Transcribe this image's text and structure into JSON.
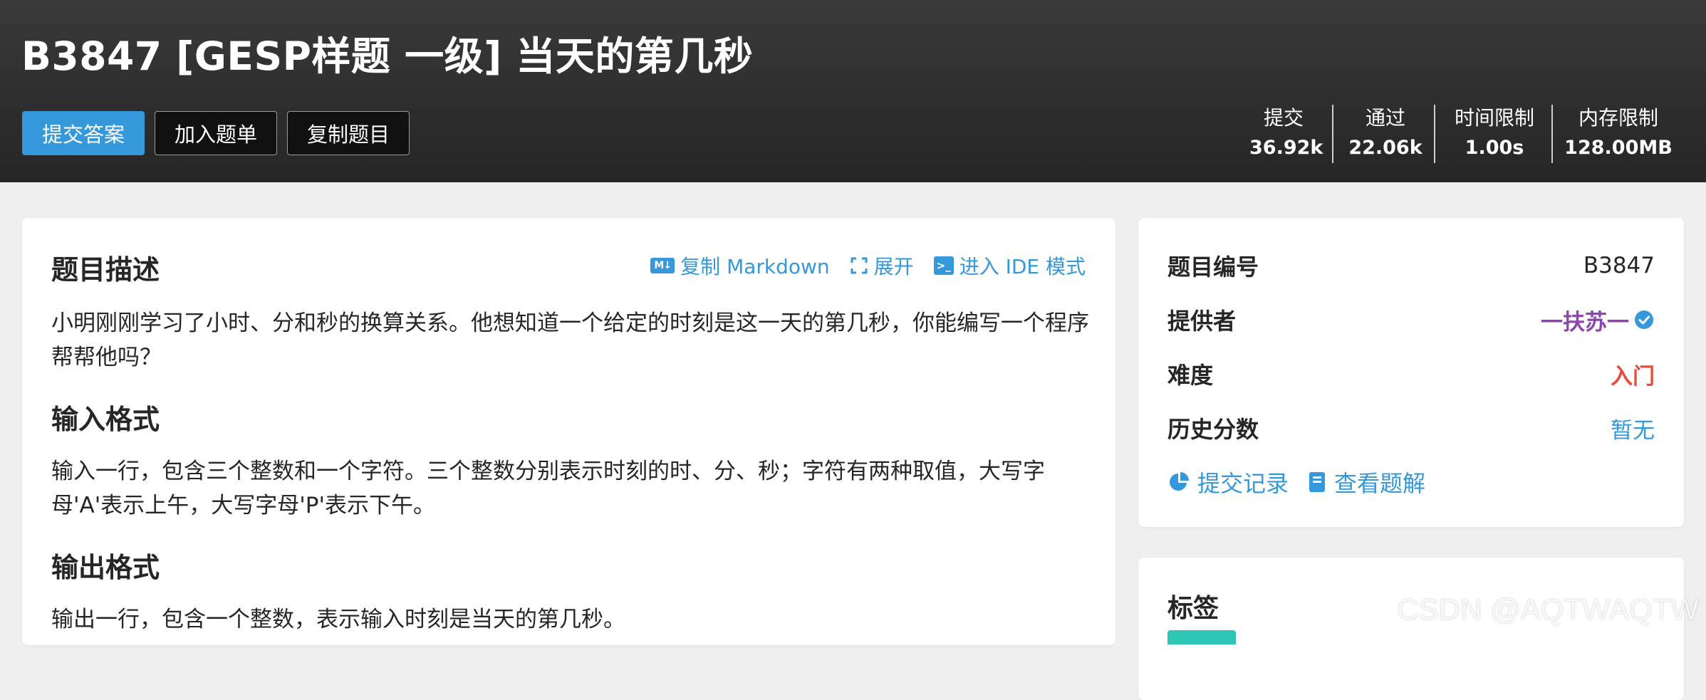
{
  "header": {
    "title": "B3847 [GESP样题 一级] 当天的第几秒",
    "buttons": {
      "submit": "提交答案",
      "add_to_list": "加入题单",
      "copy_problem": "复制题目"
    },
    "stats": [
      {
        "label": "提交",
        "value": "36.92k"
      },
      {
        "label": "通过",
        "value": "22.06k"
      },
      {
        "label": "时间限制",
        "value": "1.00s"
      },
      {
        "label": "内存限制",
        "value": "128.00MB"
      }
    ]
  },
  "problem": {
    "actions": {
      "copy_markdown": "复制 Markdown",
      "expand": "展开",
      "ide_mode": "进入 IDE 模式",
      "md_badge": "M↓",
      "term_badge": ">_"
    },
    "description_title": "题目描述",
    "description": "小明刚刚学习了小时、分和秒的换算关系。他想知道一个给定的时刻是这一天的第几秒，你能编写一个程序帮帮他吗？",
    "input_title": "输入格式",
    "input": "输入一行，包含三个整数和一个字符。三个整数分别表示时刻的时、分、秒；字符有两种取值，大写字母'A'表示上午，大写字母'P'表示下午。",
    "output_title": "输出格式",
    "output": "输出一行，包含一个整数，表示输入时刻是当天的第几秒。"
  },
  "info": {
    "problem_id_label": "题目编号",
    "problem_id": "B3847",
    "provider_label": "提供者",
    "provider": "一扶苏一",
    "difficulty_label": "难度",
    "difficulty": "入门",
    "history_label": "历史分数",
    "history": "暂无",
    "submissions_link": "提交记录",
    "solutions_link": "查看题解"
  },
  "tags": {
    "title": "标签"
  },
  "colors": {
    "accent": "#3498db",
    "provider": "#8e44ad",
    "difficulty": "#e74c3c",
    "tag": "#2ec4b6"
  },
  "watermark": "CSDN @AQTWAQTW"
}
